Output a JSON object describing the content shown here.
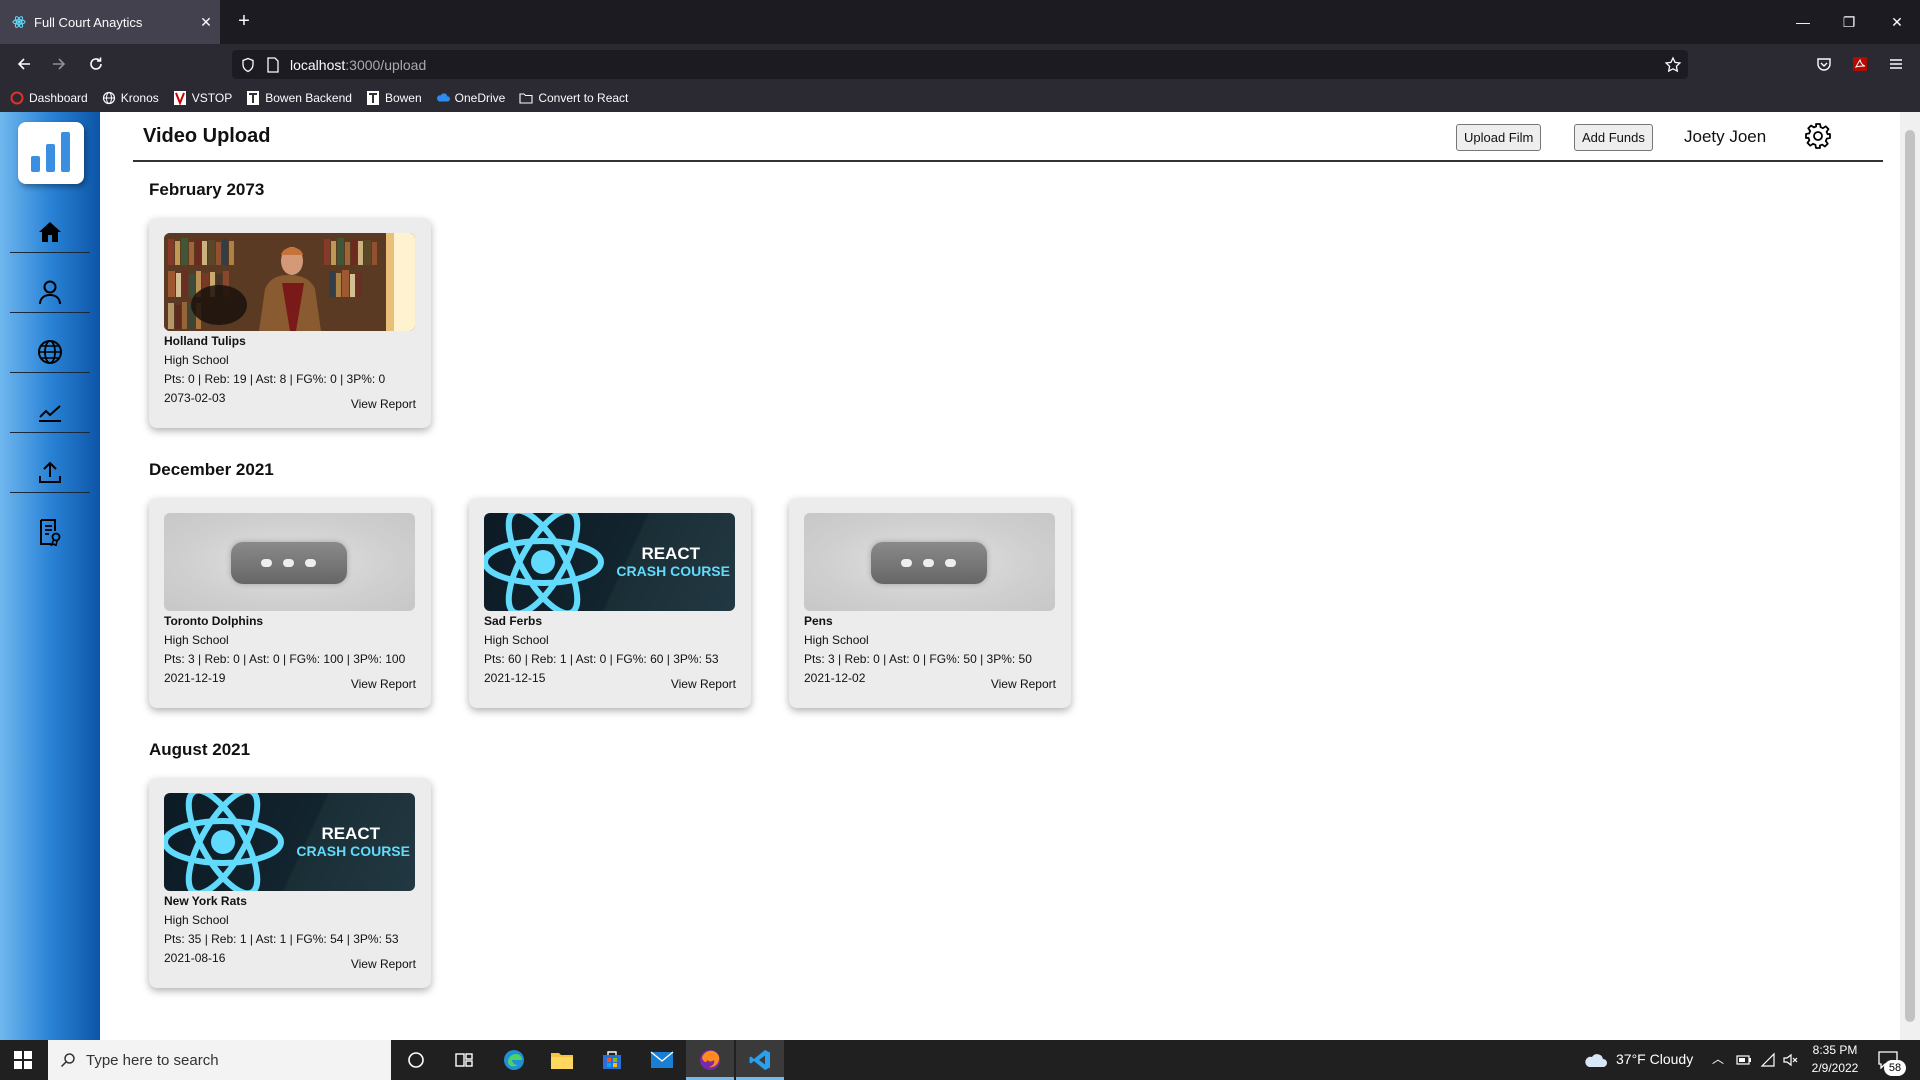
{
  "browser": {
    "tab_title": "Full Court Anaytics",
    "url_host": "localhost",
    "url_path": ":3000/upload",
    "bookmarks": [
      {
        "label": "Dashboard",
        "icon": "circle-red-icon"
      },
      {
        "label": "Kronos",
        "icon": "globe-icon"
      },
      {
        "label": "VSTOP",
        "icon": "v-logo-icon"
      },
      {
        "label": "Bowen Backend",
        "icon": "bowen-logo-icon"
      },
      {
        "label": "Bowen",
        "icon": "bowen-logo-icon"
      },
      {
        "label": "OneDrive",
        "icon": "cloud-icon"
      },
      {
        "label": "Convert to React",
        "icon": "folder-icon"
      }
    ]
  },
  "app": {
    "page_title": "Video Upload",
    "upload_film_label": "Upload Film",
    "add_funds_label": "Add Funds",
    "username": "Joety Joen",
    "sidebar": [
      "home-icon",
      "user-icon",
      "globe-icon",
      "chart-line-icon",
      "upload-icon",
      "report-icon"
    ]
  },
  "groups": [
    {
      "month": "February 2073",
      "films": [
        {
          "team": "Holland Tulips",
          "level": "High School",
          "stats": "Pts: 0 | Reb: 19 | Ast: 8 | FG%: 0 | 3P%: 0",
          "date": "2073-02-03",
          "report_label": "View Report",
          "thumbnail": "photo"
        }
      ]
    },
    {
      "month": "December 2021",
      "films": [
        {
          "team": "Toronto Dolphins",
          "level": "High School",
          "stats": "Pts: 3 | Reb: 0 | Ast: 0 | FG%: 100 | 3P%: 100",
          "date": "2021-12-19",
          "report_label": "View Report",
          "thumbnail": "placeholder"
        },
        {
          "team": "Sad Ferbs",
          "level": "High School",
          "stats": "Pts: 60 | Reb: 1 | Ast: 0 | FG%: 60 | 3P%: 53",
          "date": "2021-12-15",
          "report_label": "View Report",
          "thumbnail": "react"
        },
        {
          "team": "Pens",
          "level": "High School",
          "stats": "Pts: 3 | Reb: 0 | Ast: 0 | FG%: 50 | 3P%: 50",
          "date": "2021-12-02",
          "report_label": "View Report",
          "thumbnail": "placeholder"
        }
      ]
    },
    {
      "month": "August 2021",
      "films": [
        {
          "team": "New York Rats",
          "level": "High School",
          "stats": "Pts: 35 | Reb: 1 | Ast: 1 | FG%: 54 | 3P%: 53",
          "date": "2021-08-16",
          "report_label": "View Report",
          "thumbnail": "react"
        }
      ]
    }
  ],
  "thumbnail_text": {
    "react_line1": "REACT",
    "react_line2": "CRASH COURSE"
  },
  "taskbar": {
    "search_placeholder": "Type here to search",
    "weather": "37°F  Cloudy",
    "time": "8:35 PM",
    "date": "2/9/2022",
    "notifications": "58"
  },
  "colors": {
    "sidebar_accent": "#2a83d6",
    "react_cyan": "#61dafb"
  }
}
